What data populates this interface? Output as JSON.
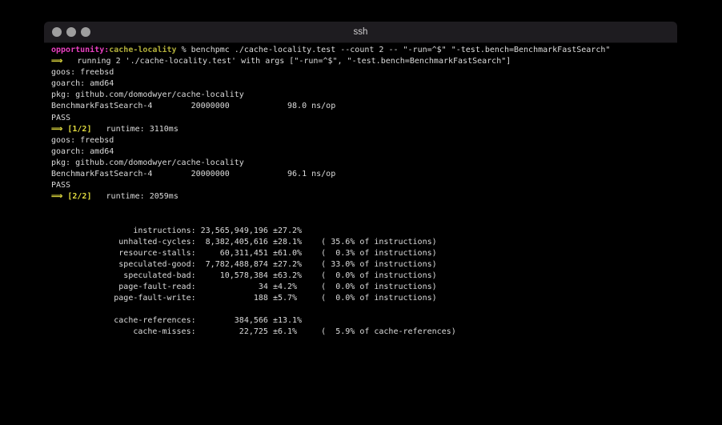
{
  "colors": {
    "bg": "#000000",
    "fg": "#dcdcdc",
    "magenta": "#e93fc0",
    "olive": "#b2af3a",
    "yellow": "#e0da3f",
    "titlebar": "#1e1c20",
    "title_text": "#d0ced0",
    "dot": "#9e9e9e"
  },
  "window": {
    "title": "ssh",
    "controls": [
      "close",
      "minimize",
      "zoom"
    ]
  },
  "terminal": {
    "prompt": {
      "host": "opportunity:",
      "dir": "cache-locality",
      "symbol": "%",
      "command": "benchpmc ./cache-locality.test --count 2 -- \"-run=^$\" \"-test.bench=BenchmarkFastSearch\""
    },
    "lines": [
      [
        {
          "t": "opportunity:",
          "c": "magenta"
        },
        {
          "t": "cache-locality",
          "c": "olive"
        },
        {
          "t": " % ",
          "c": "fg"
        },
        {
          "t": "benchpmc ./cache-locality.test --count 2 -- \"-run=^$\" \"-test.bench=BenchmarkFastSearch\"",
          "c": "fg"
        }
      ],
      [
        {
          "t": "⟹",
          "c": "yellow"
        },
        {
          "t": "   running 2 './cache-locality.test' with args [\"-run=^$\", \"-test.bench=BenchmarkFastSearch\"]",
          "c": "fg"
        }
      ],
      [
        {
          "t": "goos: freebsd",
          "c": "fg"
        }
      ],
      [
        {
          "t": "goarch: amd64",
          "c": "fg"
        }
      ],
      [
        {
          "t": "pkg: github.com/domodwyer/cache-locality",
          "c": "fg"
        }
      ],
      [
        {
          "t": "BenchmarkFastSearch-4        20000000            98.0 ns/op",
          "c": "fg"
        }
      ],
      [
        {
          "t": "PASS",
          "c": "fg"
        }
      ],
      [
        {
          "t": "⟹ [1/2]",
          "c": "yellow"
        },
        {
          "t": "   runtime: 3110ms",
          "c": "fg"
        }
      ],
      [
        {
          "t": "goos: freebsd",
          "c": "fg"
        }
      ],
      [
        {
          "t": "goarch: amd64",
          "c": "fg"
        }
      ],
      [
        {
          "t": "pkg: github.com/domodwyer/cache-locality",
          "c": "fg"
        }
      ],
      [
        {
          "t": "BenchmarkFastSearch-4        20000000            96.1 ns/op",
          "c": "fg"
        }
      ],
      [
        {
          "t": "PASS",
          "c": "fg"
        }
      ],
      [
        {
          "t": "⟹ [2/2]",
          "c": "yellow"
        },
        {
          "t": "   runtime: 2059ms",
          "c": "fg"
        }
      ],
      [],
      [],
      [
        {
          "t": "                 instructions: 23,565,949,196 ±27.2%",
          "c": "fg"
        }
      ],
      [
        {
          "t": "              unhalted-cycles:  8,382,405,616 ±28.1%    ( 35.6% of instructions)",
          "c": "fg"
        }
      ],
      [
        {
          "t": "              resource-stalls:     60,311,451 ±61.0%    (  0.3% of instructions)",
          "c": "fg"
        }
      ],
      [
        {
          "t": "              speculated-good:  7,782,488,874 ±27.2%    ( 33.0% of instructions)",
          "c": "fg"
        }
      ],
      [
        {
          "t": "               speculated-bad:     10,578,384 ±63.2%    (  0.0% of instructions)",
          "c": "fg"
        }
      ],
      [
        {
          "t": "              page-fault-read:             34 ±4.2%     (  0.0% of instructions)",
          "c": "fg"
        }
      ],
      [
        {
          "t": "             page-fault-write:            188 ±5.7%     (  0.0% of instructions)",
          "c": "fg"
        }
      ],
      [],
      [
        {
          "t": "             cache-references:        384,566 ±13.1%",
          "c": "fg"
        }
      ],
      [
        {
          "t": "                 cache-misses:         22,725 ±6.1%     (  5.9% of cache-references)",
          "c": "fg"
        }
      ]
    ]
  }
}
